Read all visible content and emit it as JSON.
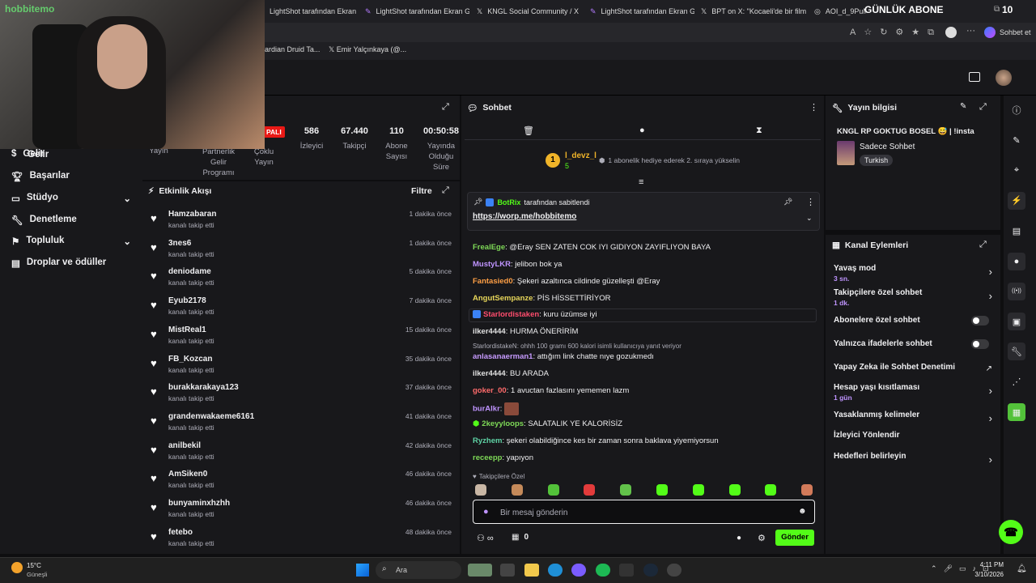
{
  "browser": {
    "tabs": [
      {
        "label": "LightShot tarafından Ekran G"
      },
      {
        "label": "LightShot tarafından Ekran G"
      },
      {
        "label": "KNGL Social Community / X"
      },
      {
        "label": "LightShot tarafından Ekran G"
      },
      {
        "label": "BPT on X: \"Kocaeli'de bir film"
      },
      {
        "label": "AOI_d_9PuMq"
      }
    ],
    "tab_count_badge": "0",
    "overlay_title": "GÜNLÜK ABONE",
    "overlay_count": "10",
    "copilot_label": "Sohbet et",
    "favorites": [
      {
        "label": "ardian Druid Ta..."
      },
      {
        "label": "Emir Yalçınkaya (@..."
      }
    ],
    "watermark": "hobbitemo"
  },
  "sidebar": {
    "items": [
      {
        "label": "Gelir"
      },
      {
        "label": "Başarılar"
      },
      {
        "label": "Stüdyo"
      },
      {
        "label": "Denetleme"
      },
      {
        "label": "Topluluk"
      },
      {
        "label": "Droplar ve ödüller"
      }
    ]
  },
  "stats": {
    "live_badge": "PALI",
    "items": [
      {
        "value": "",
        "label": "Yayın"
      },
      {
        "value": "",
        "label": "Partnerlik Gelir Programı"
      },
      {
        "value": "",
        "label": "Çoklu Yayın"
      },
      {
        "value": "586",
        "label": "İzleyici"
      },
      {
        "value": "67.440",
        "label": "Takipçi"
      },
      {
        "value": "110",
        "label": "Abone Sayısı"
      },
      {
        "value": "00:50:58",
        "label": "Yayında Olduğu Süre"
      }
    ]
  },
  "activity": {
    "title": "Etkinlik Akışı",
    "filter": "Filtre",
    "rows": [
      {
        "name": "Hamzabaran",
        "sub": "kanalı takip etti",
        "time": "1 dakika önce"
      },
      {
        "name": "3nes6",
        "sub": "kanalı takip etti",
        "time": "1 dakika önce"
      },
      {
        "name": "deniodame",
        "sub": "kanalı takip etti",
        "time": "5 dakika önce"
      },
      {
        "name": "Eyub2178",
        "sub": "kanalı takip etti",
        "time": "7 dakika önce"
      },
      {
        "name": "MistReal1",
        "sub": "kanalı takip etti",
        "time": "15 dakika önce"
      },
      {
        "name": "FB_Kozcan",
        "sub": "kanalı takip etti",
        "time": "35 dakika önce"
      },
      {
        "name": "burakkarakaya123",
        "sub": "kanalı takip etti",
        "time": "37 dakika önce"
      },
      {
        "name": "grandenwakaeme6161",
        "sub": "kanalı takip etti",
        "time": "41 dakika önce"
      },
      {
        "name": "anilbekil",
        "sub": "kanalı takip etti",
        "time": "42 dakika önce"
      },
      {
        "name": "AmSiken0",
        "sub": "kanalı takip etti",
        "time": "46 dakika önce"
      },
      {
        "name": "bunyaminxhzhh",
        "sub": "kanalı takip etti",
        "time": "46 dakika önce"
      },
      {
        "name": "fetebo",
        "sub": "kanalı takip etti",
        "time": "48 dakika önce"
      }
    ]
  },
  "chat": {
    "title": "Sohbet",
    "gift_user": "l_devz_l",
    "gift_count": "5",
    "gift_rank": "1",
    "gift_text": "1 abonelik hediye ederek 2. sıraya yükselin",
    "pinned_by": "BotRix",
    "pinned_label": "tarafından sabitlendi",
    "pinned_link": "https://worp.me/hobbitemo",
    "messages": [
      {
        "user": "FrealEge",
        "color": "#7ed957",
        "text": "@Eray SEN ZATEN COK IYI GIDIYON ZAYIFLIYON BAYA"
      },
      {
        "user": "MustyLKR",
        "color": "#bf94ff",
        "text": "jelibon bok ya"
      },
      {
        "user": "Fantasied0",
        "color": "#ff9f45",
        "text": "Şekeri azaltınca cildinde güzelleşti @Eray"
      },
      {
        "user": "AngutSempanze",
        "color": "#e7d65a",
        "text": "PİS HİSSETTİRİYOR"
      },
      {
        "user": "Starlordistaken",
        "color": "#ff4d6d",
        "text": "kuru üzümse iyi"
      },
      {
        "user": "ilker4444",
        "color": "#e0e0e0",
        "text": "HURMA ÖNERİRİM"
      },
      {
        "user": "anlasanaerman1",
        "color": "#c79bff",
        "text": "attığım link chatte nıye gozukmedı"
      },
      {
        "user": "ilker4444",
        "color": "#e0e0e0",
        "text": "BU ARADA"
      },
      {
        "user": "goker_00",
        "color": "#ff6b6b",
        "text": "1 avuctan fazlasını yememen lazm"
      },
      {
        "user": "burAlkr",
        "color": "#bf94ff",
        "text": ""
      },
      {
        "user": "2keyyloops",
        "color": "#7ed957",
        "text": "SALATALIK YE KALORİSİZ"
      },
      {
        "user": "Ryzhem",
        "color": "#5fd3a5",
        "text": "şekeri olabildiğince kes bir zaman sonra baklava yiyemiyorsun"
      },
      {
        "user": "receepp",
        "color": "#7ed957",
        "text": "yapıyon"
      }
    ],
    "reply_note": "StarlordistakeN: ohhh 100 gramı 600 kalori isimli kullanıcıya yanıt veriyor",
    "followers_only_label": "Takipçilere Özel",
    "input_placeholder": "Bir mesaj gönderin",
    "points": "0",
    "send_label": "Gönder"
  },
  "stream_info": {
    "title": "Yayın bilgisi",
    "stream_title": "KNGL RP GOKTUG BOSEL 😅 | !insta",
    "category": "Sadece Sohbet",
    "tag": "Turkish"
  },
  "channel_actions": {
    "title": "Kanal Eylemleri",
    "rows": [
      {
        "label": "Yavaş mod",
        "sub": "3 sn."
      },
      {
        "label": "Takipçilere özel sohbet",
        "sub": "1 dk."
      },
      {
        "label": "Abonelere özel sohbet",
        "sub": ""
      },
      {
        "label": "Yalnızca ifadelerle sohbet",
        "sub": ""
      },
      {
        "label": "Yapay Zeka ile Sohbet Denetimi",
        "sub": ""
      },
      {
        "label": "Hesap yaşı kısıtlaması",
        "sub": "1 gün"
      },
      {
        "label": "Yasaklanmış kelimeler",
        "sub": ""
      },
      {
        "label": "İzleyici Yönlendir",
        "sub": ""
      },
      {
        "label": "Hedefleri belirleyin",
        "sub": ""
      }
    ]
  },
  "taskbar": {
    "weather_temp": "15°C",
    "weather_desc": "Güneşli",
    "search_label": "Ara",
    "time": "4:11 PM",
    "date": "3/10/2026"
  },
  "colors": {
    "accent": "#53fc18",
    "bg": "#0e0e10",
    "panel": "#18181b",
    "purple": "#bf94ff"
  }
}
